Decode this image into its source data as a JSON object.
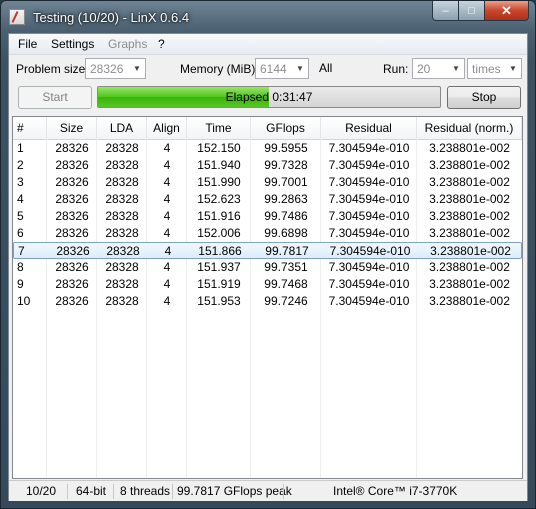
{
  "window": {
    "title": "Testing (10/20) - LinX 0.6.4",
    "controls": {
      "minimize": "–",
      "maximize": "□",
      "close": "✕"
    }
  },
  "menu": {
    "items": [
      {
        "label": "File",
        "enabled": true
      },
      {
        "label": "Settings",
        "enabled": true
      },
      {
        "label": "Graphs",
        "enabled": false
      },
      {
        "label": "?",
        "enabled": true
      }
    ]
  },
  "settings": {
    "problem_size_label": "Problem size:",
    "problem_size_value": "28326",
    "memory_label": "Memory (MiB):",
    "memory_value": "6144",
    "memory_all": "All",
    "run_label": "Run:",
    "run_value": "20",
    "run_unit": "times"
  },
  "controls": {
    "start_label": "Start",
    "stop_label": "Stop",
    "progress_text": "Elapsed 0:31:47",
    "progress_fraction": 0.5
  },
  "table": {
    "columns": [
      "#",
      "Size",
      "LDA",
      "Align",
      "Time",
      "GFlops",
      "Residual",
      "Residual (norm.)"
    ],
    "selected_row": 6,
    "rows": [
      [
        "1",
        "28326",
        "28328",
        "4",
        "152.150",
        "99.5955",
        "7.304594e-010",
        "3.238801e-002"
      ],
      [
        "2",
        "28326",
        "28328",
        "4",
        "151.940",
        "99.7328",
        "7.304594e-010",
        "3.238801e-002"
      ],
      [
        "3",
        "28326",
        "28328",
        "4",
        "151.990",
        "99.7001",
        "7.304594e-010",
        "3.238801e-002"
      ],
      [
        "4",
        "28326",
        "28328",
        "4",
        "152.623",
        "99.2863",
        "7.304594e-010",
        "3.238801e-002"
      ],
      [
        "5",
        "28326",
        "28328",
        "4",
        "151.916",
        "99.7486",
        "7.304594e-010",
        "3.238801e-002"
      ],
      [
        "6",
        "28326",
        "28328",
        "4",
        "152.006",
        "99.6898",
        "7.304594e-010",
        "3.238801e-002"
      ],
      [
        "7",
        "28326",
        "28328",
        "4",
        "151.866",
        "99.7817",
        "7.304594e-010",
        "3.238801e-002"
      ],
      [
        "8",
        "28326",
        "28328",
        "4",
        "151.937",
        "99.7351",
        "7.304594e-010",
        "3.238801e-002"
      ],
      [
        "9",
        "28326",
        "28328",
        "4",
        "151.919",
        "99.7468",
        "7.304594e-010",
        "3.238801e-002"
      ],
      [
        "10",
        "28326",
        "28328",
        "4",
        "151.953",
        "99.7246",
        "7.304594e-010",
        "3.238801e-002"
      ]
    ]
  },
  "status": {
    "progress": "10/20",
    "arch": "64-bit",
    "threads": "8 threads",
    "peak": "99.7817 GFlops peak",
    "cpu": "Intel® Core™ i7-3770K"
  },
  "colors": {
    "progress_fill": "#50c51d",
    "selection": "#dcecfb"
  }
}
